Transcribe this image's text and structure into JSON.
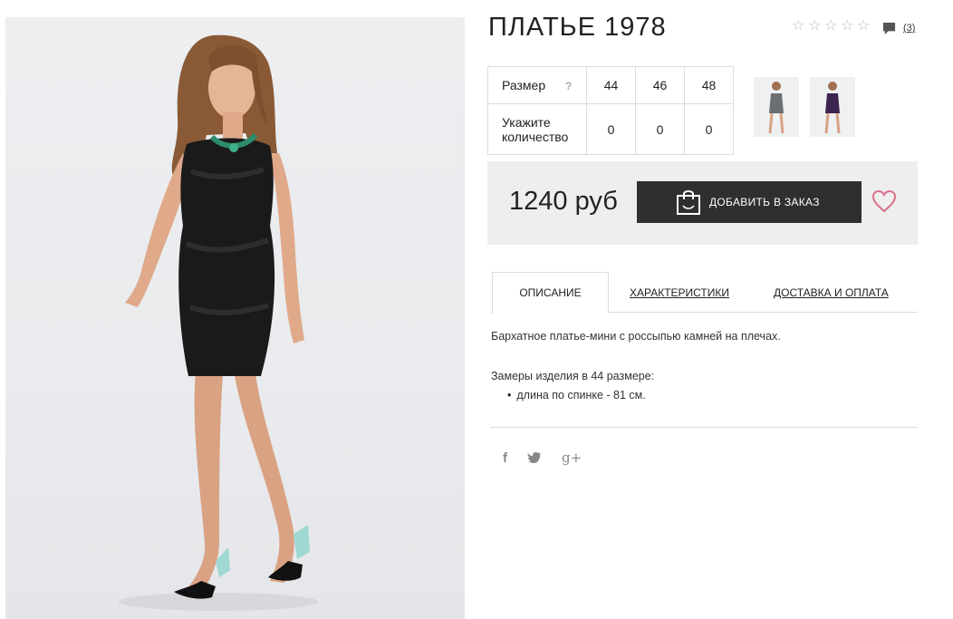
{
  "product": {
    "title": "ПЛАТЬЕ 1978",
    "rating_stars": 0,
    "rating_max": 5,
    "comments_count": "(3)",
    "price": "1240 руб",
    "add_to_cart_label": "ДОБАВИТЬ В ЗАКАЗ"
  },
  "size_table": {
    "size_label": "Размер",
    "help_mark": "?",
    "quantity_label_line1": "Укажите",
    "quantity_label_line2": "количество",
    "sizes": [
      "44",
      "46",
      "48"
    ],
    "quantities": [
      "0",
      "0",
      "0"
    ]
  },
  "thumbnails": [
    {
      "icon": "grey-dress-thumbnail",
      "dress_color": "#6b6e72"
    },
    {
      "icon": "purple-dress-thumbnail",
      "dress_color": "#3c2350"
    }
  ],
  "tabs": {
    "description": "ОПИСАНИЕ",
    "characteristics": "ХАРАКТЕРИСТИКИ",
    "delivery": "ДОСТАВКА И ОПЛАТА"
  },
  "description": {
    "text": "Бархатное платье-мини с россыпью камней на плечах.",
    "measure_title": "Замеры изделия в 44 размере:",
    "measure_items": [
      "длина по спинке - 81 см."
    ]
  },
  "social": {
    "facebook": "f",
    "twitter": "twitter-bird",
    "googleplus": "g+"
  },
  "colors": {
    "button_bg": "#2f2f2f",
    "price_box_bg": "#eeeeee",
    "heart": "#d9708a",
    "border": "#dcdcdc"
  }
}
